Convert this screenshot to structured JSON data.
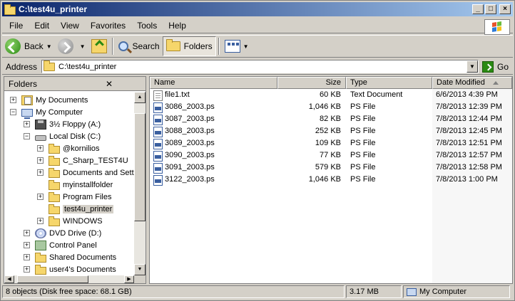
{
  "window": {
    "title": "C:\\test4u_printer"
  },
  "menu": [
    "File",
    "Edit",
    "View",
    "Favorites",
    "Tools",
    "Help"
  ],
  "toolbar": {
    "back": "Back",
    "search": "Search",
    "folders": "Folders"
  },
  "address": {
    "label": "Address",
    "value": "C:\\test4u_printer",
    "go": "Go"
  },
  "folders_pane": {
    "title": "Folders",
    "items": [
      {
        "label": "My Documents",
        "icon": "my-documents-icon",
        "expander": "+"
      },
      {
        "label": "My Computer",
        "icon": "my-computer-icon",
        "expander": "−"
      },
      {
        "label": "3½ Floppy (A:)",
        "icon": "floppy-icon",
        "expander": "+"
      },
      {
        "label": "Local Disk (C:)",
        "icon": "local-disk-icon",
        "expander": "−"
      },
      {
        "label": "@kornilios",
        "icon": "folder-icon",
        "expander": "+"
      },
      {
        "label": "C_Sharp_TEST4U",
        "icon": "folder-icon",
        "expander": "+"
      },
      {
        "label": "Documents and Setti",
        "icon": "folder-icon",
        "expander": "+"
      },
      {
        "label": "myinstallfolder",
        "icon": "folder-icon",
        "expander": ""
      },
      {
        "label": "Program Files",
        "icon": "folder-icon",
        "expander": "+"
      },
      {
        "label": "test4u_printer",
        "icon": "folder-open-icon",
        "expander": "",
        "selected": true
      },
      {
        "label": "WINDOWS",
        "icon": "folder-icon",
        "expander": "+"
      },
      {
        "label": "DVD Drive (D:)",
        "icon": "dvd-drive-icon",
        "expander": "+"
      },
      {
        "label": "Control Panel",
        "icon": "control-panel-icon",
        "expander": "+"
      },
      {
        "label": "Shared Documents",
        "icon": "folder-icon",
        "expander": "+"
      },
      {
        "label": "user4's Documents",
        "icon": "folder-icon",
        "expander": "+"
      }
    ]
  },
  "file_list": {
    "columns": {
      "name": "Name",
      "size": "Size",
      "type": "Type",
      "date": "Date Modified"
    },
    "rows": [
      {
        "name": "file1.txt",
        "size": "60 KB",
        "type": "Text Document",
        "date": "6/6/2013 4:39 PM",
        "icon": "text-file-icon"
      },
      {
        "name": "3086_2003.ps",
        "size": "1,046 KB",
        "type": "PS File",
        "date": "7/8/2013 12:39 PM",
        "icon": "ps-file-icon"
      },
      {
        "name": "3087_2003.ps",
        "size": "82 KB",
        "type": "PS File",
        "date": "7/8/2013 12:44 PM",
        "icon": "ps-file-icon"
      },
      {
        "name": "3088_2003.ps",
        "size": "252 KB",
        "type": "PS File",
        "date": "7/8/2013 12:45 PM",
        "icon": "ps-file-icon"
      },
      {
        "name": "3089_2003.ps",
        "size": "109 KB",
        "type": "PS File",
        "date": "7/8/2013 12:51 PM",
        "icon": "ps-file-icon"
      },
      {
        "name": "3090_2003.ps",
        "size": "77 KB",
        "type": "PS File",
        "date": "7/8/2013 12:57 PM",
        "icon": "ps-file-icon"
      },
      {
        "name": "3091_2003.ps",
        "size": "579 KB",
        "type": "PS File",
        "date": "7/8/2013 12:58 PM",
        "icon": "ps-file-icon"
      },
      {
        "name": "3122_2003.ps",
        "size": "1,046 KB",
        "type": "PS File",
        "date": "7/8/2013 1:00 PM",
        "icon": "ps-file-icon"
      }
    ]
  },
  "status": {
    "objects": "8 objects (Disk free space: 68.1 GB)",
    "size": "3.17 MB",
    "location": "My Computer"
  }
}
